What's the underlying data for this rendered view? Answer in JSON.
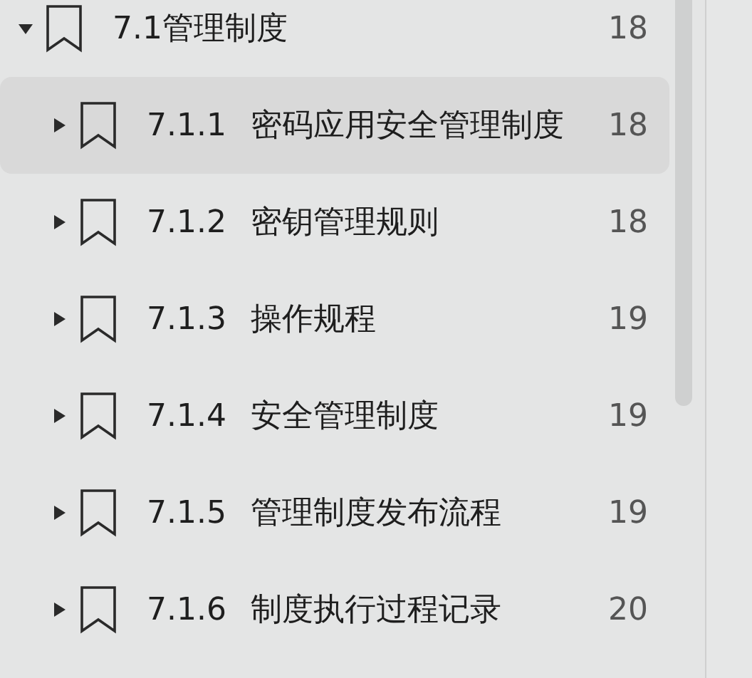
{
  "outline": {
    "title": "7.1管理制度",
    "page": "18",
    "expanded": true,
    "selected": false,
    "children": [
      {
        "number": "7.1.1",
        "title": "密码应用安全管理制度",
        "page": "18",
        "expanded": false,
        "selected": true
      },
      {
        "number": "7.1.2",
        "title": "密钥管理规则",
        "page": "18",
        "expanded": false,
        "selected": false
      },
      {
        "number": "7.1.3",
        "title": "操作规程",
        "page": "19",
        "expanded": false,
        "selected": false
      },
      {
        "number": "7.1.4",
        "title": "安全管理制度",
        "page": "19",
        "expanded": false,
        "selected": false
      },
      {
        "number": "7.1.5",
        "title": "管理制度发布流程",
        "page": "19",
        "expanded": false,
        "selected": false
      },
      {
        "number": "7.1.6",
        "title": "制度执行过程记录",
        "page": "20",
        "expanded": false,
        "selected": false
      }
    ]
  }
}
